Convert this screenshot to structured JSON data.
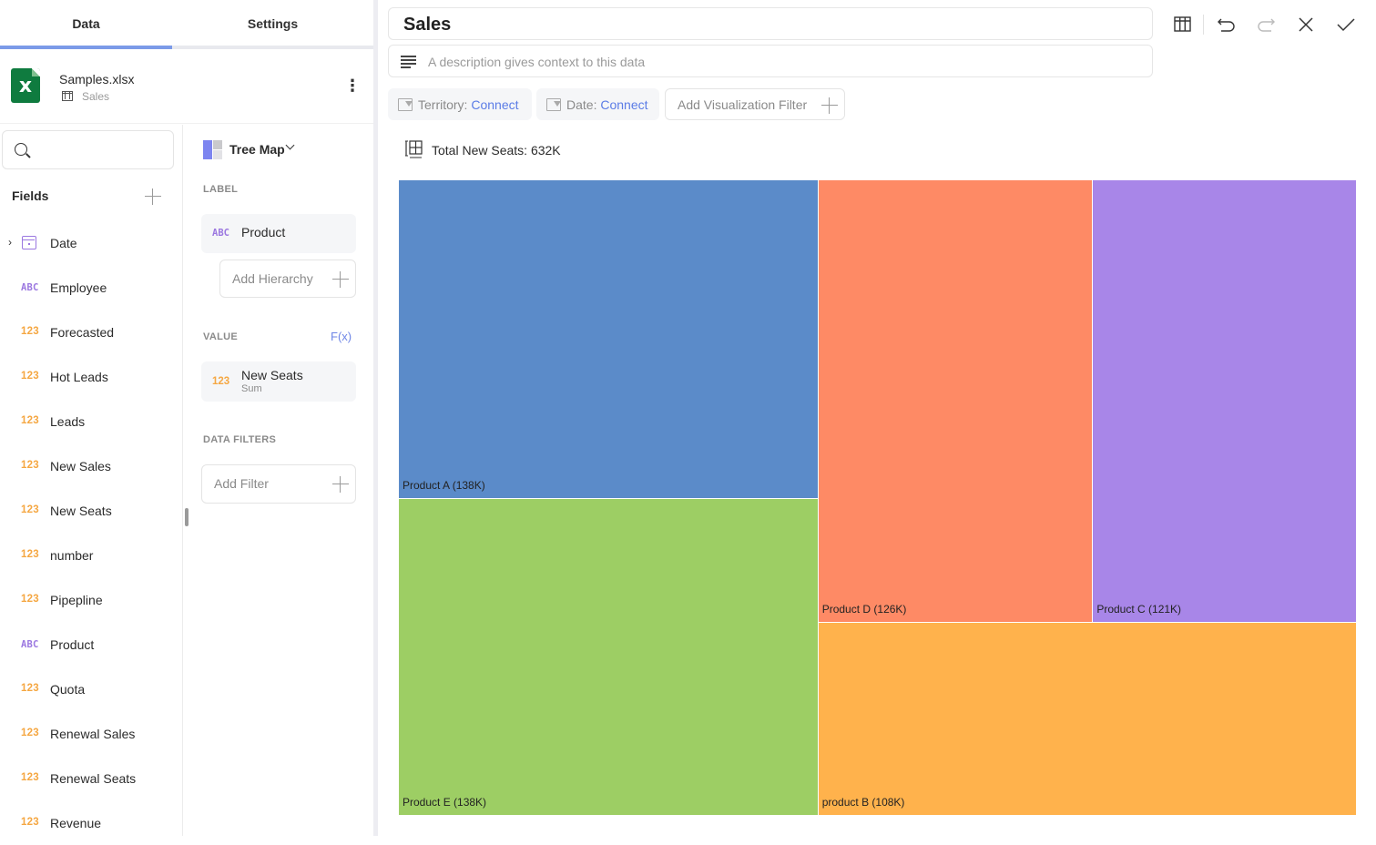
{
  "left_panel": {
    "tabs": [
      {
        "label": "Data",
        "active": true
      },
      {
        "label": "Settings",
        "active": false
      }
    ],
    "source": {
      "file_name": "Samples.xlsx",
      "sheet_name": "Sales",
      "icon": "excel-icon"
    },
    "search": {
      "placeholder": "",
      "value": ""
    },
    "fields_title": "Fields",
    "fields": [
      {
        "type": "date",
        "type_label": "",
        "label": "Date",
        "expandable": true
      },
      {
        "type": "text",
        "type_label": "ABC",
        "label": "Employee"
      },
      {
        "type": "number",
        "type_label": "123",
        "label": "Forecasted"
      },
      {
        "type": "number",
        "type_label": "123",
        "label": "Hot Leads"
      },
      {
        "type": "number",
        "type_label": "123",
        "label": "Leads"
      },
      {
        "type": "number",
        "type_label": "123",
        "label": "New Sales"
      },
      {
        "type": "number",
        "type_label": "123",
        "label": "New Seats"
      },
      {
        "type": "number",
        "type_label": "123",
        "label": "number"
      },
      {
        "type": "number",
        "type_label": "123",
        "label": "Pipepline"
      },
      {
        "type": "text",
        "type_label": "ABC",
        "label": "Product"
      },
      {
        "type": "number",
        "type_label": "123",
        "label": "Quota"
      },
      {
        "type": "number",
        "type_label": "123",
        "label": "Renewal Sales"
      },
      {
        "type": "number",
        "type_label": "123",
        "label": "Renewal Seats"
      },
      {
        "type": "number",
        "type_label": "123",
        "label": "Revenue"
      }
    ],
    "config": {
      "visualization": "Tree Map",
      "label_section": "LABEL",
      "label_field": {
        "type_label": "ABC",
        "label": "Product"
      },
      "add_hierarchy": "Add Hierarchy",
      "value_section": "VALUE",
      "fx_label": "F(x)",
      "value_field": {
        "type_label": "123",
        "label": "New Seats",
        "aggregation": "Sum"
      },
      "data_filters_section": "DATA FILTERS",
      "add_filter": "Add Filter"
    }
  },
  "header": {
    "title": "Sales",
    "description_placeholder": "A description gives context to this data",
    "toolbar": [
      "table-view-icon",
      "undo-icon",
      "redo-icon",
      "close-icon",
      "check-icon"
    ]
  },
  "filters": [
    {
      "name": "Territory:",
      "action": "Connect"
    },
    {
      "name": "Date:",
      "action": "Connect"
    }
  ],
  "add_viz_filter": "Add Visualization Filter",
  "summary": "Total New Seats: 632K",
  "colors": {
    "accent": "#7b9ae8",
    "link": "#5b7ce6",
    "number_type": "#f5a742",
    "text_type": "#9b77e0"
  },
  "chart_data": {
    "type": "treemap",
    "title": "Total New Seats: 632K",
    "measure": "New Seats (Sum)",
    "unit": "K",
    "nodes": [
      {
        "label": "Product A",
        "value": 138,
        "display": "Product A (138K)",
        "color": "#5b8bc9"
      },
      {
        "label": "Product E",
        "value": 138,
        "display": "Product E (138K)",
        "color": "#9dce64"
      },
      {
        "label": "Product D",
        "value": 126,
        "display": "Product D (126K)",
        "color": "#fe8a65"
      },
      {
        "label": "Product C",
        "value": 121,
        "display": "Product C (121K)",
        "color": "#a886e8"
      },
      {
        "label": "product B",
        "value": 108,
        "display": "product B (108K)",
        "color": "#ffb24c"
      }
    ]
  }
}
